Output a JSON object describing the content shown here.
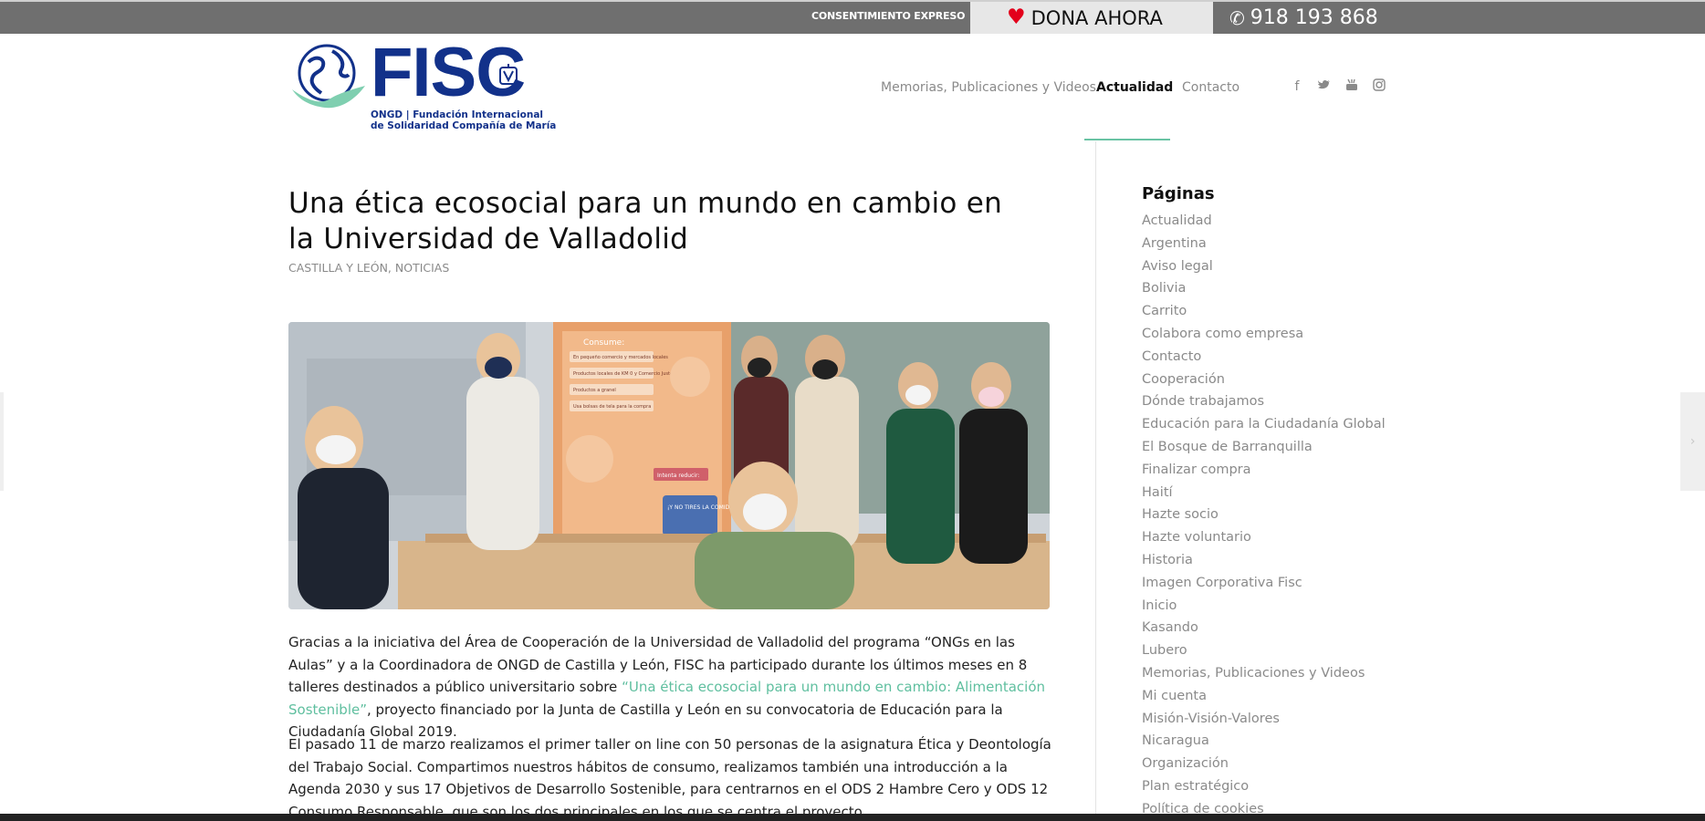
{
  "topbar": {
    "consent": "CONSENTIMIENTO EXPRESO",
    "donate": "DONA AHORA",
    "phone": "918 193 868",
    "colors": {
      "bar": "#6f6f6f",
      "heart": "#e3001b"
    }
  },
  "logo": {
    "brand": "FISC",
    "line1": "ONGD | Fundación Internacional",
    "line2": "de Solidaridad Compañía de María"
  },
  "nav": {
    "items": [
      {
        "label": "Memorias, Publicaciones y Videos"
      },
      {
        "label": "Actualidad"
      },
      {
        "label": "Contacto"
      }
    ],
    "active_index": 1,
    "accent": "#69c3a4"
  },
  "social": [
    "facebook-icon",
    "twitter-icon",
    "youtube-icon",
    "instagram-icon"
  ],
  "article": {
    "title": "Una ética ecosocial para un mundo en cambio en la Universidad de Valladolid",
    "categories": "CASTILLA Y LEÓN, NOTICIAS",
    "p1_before": "Gracias a la iniciativa del Área de Cooperación de la Universidad de Valladolid del programa “ONGs en las Aulas” y a la Coordinadora de ONGD de Castilla y León, FISC ha participado durante los últimos meses en 8 talleres destinados a público universitario sobre ",
    "p1_link": "“Una ética ecosocial para un mundo en cambio: Alimentación Sostenible”",
    "p1_after": ", proyecto financiado por la Junta de Castilla y León en su convocatoria de Educación para la Ciudadanía Global 2019.",
    "p2": "El pasado 11 de marzo realizamos el primer taller on line con 50 personas de la asignatura Ética y Deontología del Trabajo Social. Compartimos nuestros hábitos de consumo, realizamos también una introducción a la Agenda 2030 y sus 17 Objetivos de Desarrollo Sostenible, para centrarnos en el ODS 2 Hambre Cero y ODS 12 Consumo Responsable, que son los dos principales en los que se centra el proyecto.",
    "poster": {
      "heading": "Consume:",
      "lines": [
        "En pequeño comercio y mercados locales",
        "Productos locales de KM 0 y Comercio Justo",
        "Productos a granel",
        "Usa bolsas de tela para la compra"
      ],
      "reduce": "Intenta reducir:",
      "badge": "¡Y NO TIRES LA COMIDA!"
    }
  },
  "sidebar": {
    "title": "Páginas",
    "items": [
      "Actualidad",
      "Argentina",
      "Aviso legal",
      "Bolivia",
      "Carrito",
      "Colabora como empresa",
      "Contacto",
      "Cooperación",
      "Dónde trabajamos",
      "Educación para la Ciudadanía Global",
      "El Bosque de Barranquilla",
      "Finalizar compra",
      "Haití",
      "Hazte socio",
      "Hazte voluntario",
      "Historia",
      "Imagen Corporativa Fisc",
      "Inicio",
      "Kasando",
      "Lubero",
      "Memorias, Publicaciones y Videos",
      "Mi cuenta",
      "Misión-Visión-Valores",
      "Nicaragua",
      "Organización",
      "Plan estratégico",
      "Política de cookies"
    ]
  }
}
